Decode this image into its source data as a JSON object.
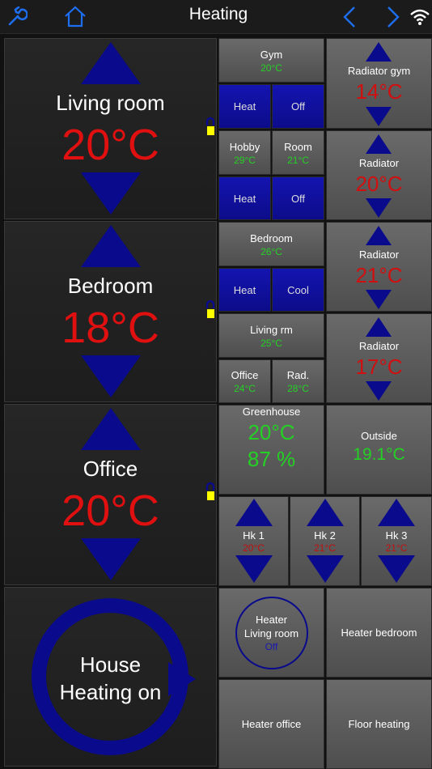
{
  "header": {
    "title": "Heating"
  },
  "rooms": [
    {
      "name": "Living room",
      "temp": "20°C"
    },
    {
      "name": "Bedroom",
      "temp": "18°C"
    },
    {
      "name": "Office",
      "temp": "20°C"
    }
  ],
  "house": {
    "line1": "House",
    "line2": "Heating on"
  },
  "tiles": {
    "gym": {
      "label": "Gym",
      "value": "20°C"
    },
    "heat1": "Heat",
    "off1": "Off",
    "hobby": {
      "label": "Hobby",
      "value": "29°C"
    },
    "room": {
      "label": "Room",
      "value": "21°C"
    },
    "heat2": "Heat",
    "off2": "Off",
    "bedroom": {
      "label": "Bedroom",
      "value": "26°C"
    },
    "heat3": "Heat",
    "cool3": "Cool",
    "livingrm": {
      "label": "Living rm",
      "value": "25°C"
    },
    "office": {
      "label": "Office",
      "value": "24°C"
    },
    "rad": {
      "label": "Rad.",
      "value": "28°C"
    },
    "greenhouse": {
      "label": "Greenhouse",
      "temp": "20°C",
      "humidity": "87 %"
    },
    "outside": {
      "label": "Outside",
      "value": "19.1°C"
    }
  },
  "radiators": [
    {
      "label": "Radiator gym",
      "temp": "14°C"
    },
    {
      "label": "Radiator",
      "temp": "20°C"
    },
    {
      "label": "Radiator",
      "temp": "21°C"
    },
    {
      "label": "Radiator",
      "temp": "17°C"
    }
  ],
  "hk": [
    {
      "label": "Hk 1",
      "temp": "20°C"
    },
    {
      "label": "Hk 2",
      "temp": "21°C"
    },
    {
      "label": "Hk 3",
      "temp": "21°C"
    }
  ],
  "heaters": {
    "living": {
      "line1": "Heater",
      "line2": "Living room",
      "state": "Off"
    },
    "bedroom": "Heater bedroom",
    "office": "Heater office",
    "floor": "Floor heating"
  },
  "colors": {
    "blue": "#0a0a8c",
    "red": "#e01010",
    "green": "#25d025",
    "lock": "#ffff00",
    "navblue": "#1e6ef0"
  },
  "icons": [
    "wrench-icon",
    "home-icon",
    "chevron-left-icon",
    "chevron-right-icon",
    "wifi-icon",
    "lock-icon"
  ]
}
